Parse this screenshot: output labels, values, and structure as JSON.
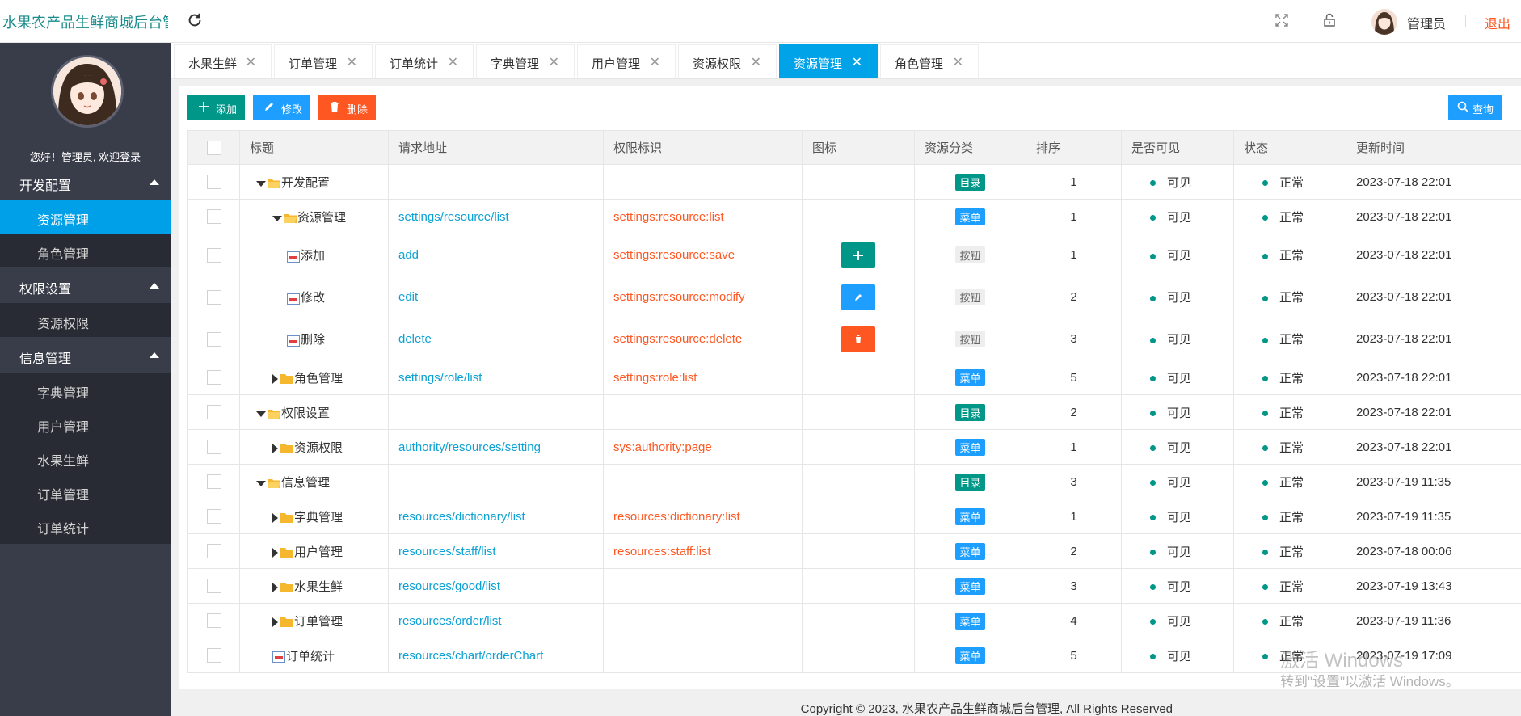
{
  "header": {
    "app_title": "水果农产品生鲜商城后台管",
    "user_name": "管理员",
    "logout": "退出"
  },
  "sidebar": {
    "welcome": "您好！管理员, 欢迎登录",
    "groups": [
      {
        "label": "开发配置",
        "items": [
          "资源管理",
          "角色管理"
        ]
      },
      {
        "label": "权限设置",
        "items": [
          "资源权限"
        ]
      },
      {
        "label": "信息管理",
        "items": [
          "字典管理",
          "用户管理",
          "水果生鲜",
          "订单管理",
          "订单统计"
        ]
      }
    ],
    "active_item": "资源管理"
  },
  "tabs": [
    "水果生鲜",
    "订单管理",
    "订单统计",
    "字典管理",
    "用户管理",
    "资源权限",
    "资源管理",
    "角色管理"
  ],
  "active_tab": "资源管理",
  "toolbar": {
    "add": "添加",
    "edit": "修改",
    "delete": "删除",
    "query": "查询"
  },
  "table": {
    "headers": [
      "标题",
      "请求地址",
      "权限标识",
      "图标",
      "资源分类",
      "排序",
      "是否可见",
      "状态",
      "更新时间"
    ],
    "rows": [
      {
        "title": "开发配置",
        "level": 0,
        "node": "open",
        "url": "",
        "perm": "",
        "icon": "",
        "type": "目录",
        "sort": "1",
        "visible": "可见",
        "status": "正常",
        "time": "2023-07-18 22:01"
      },
      {
        "title": "资源管理",
        "level": 1,
        "node": "open",
        "url": "settings/resource/list",
        "perm": "settings:resource:list",
        "icon": "",
        "type": "菜单",
        "sort": "1",
        "visible": "可见",
        "status": "正常",
        "time": "2023-07-18 22:01"
      },
      {
        "title": "添加",
        "level": 2,
        "node": "leaf",
        "url": "add",
        "perm": "settings:resource:save",
        "icon": "add",
        "type": "按钮",
        "sort": "1",
        "visible": "可见",
        "status": "正常",
        "time": "2023-07-18 22:01"
      },
      {
        "title": "修改",
        "level": 2,
        "node": "leaf",
        "url": "edit",
        "perm": "settings:resource:modify",
        "icon": "edit",
        "type": "按钮",
        "sort": "2",
        "visible": "可见",
        "status": "正常",
        "time": "2023-07-18 22:01"
      },
      {
        "title": "删除",
        "level": 2,
        "node": "leaf",
        "url": "delete",
        "perm": "settings:resource:delete",
        "icon": "delete",
        "type": "按钮",
        "sort": "3",
        "visible": "可见",
        "status": "正常",
        "time": "2023-07-18 22:01"
      },
      {
        "title": "角色管理",
        "level": 1,
        "node": "closed",
        "url": "settings/role/list",
        "perm": "settings:role:list",
        "icon": "",
        "type": "菜单",
        "sort": "5",
        "visible": "可见",
        "status": "正常",
        "time": "2023-07-18 22:01"
      },
      {
        "title": "权限设置",
        "level": 0,
        "node": "open",
        "url": "",
        "perm": "",
        "icon": "",
        "type": "目录",
        "sort": "2",
        "visible": "可见",
        "status": "正常",
        "time": "2023-07-18 22:01"
      },
      {
        "title": "资源权限",
        "level": 1,
        "node": "closed",
        "url": "authority/resources/setting",
        "perm": "sys:authority:page",
        "icon": "",
        "type": "菜单",
        "sort": "1",
        "visible": "可见",
        "status": "正常",
        "time": "2023-07-18 22:01"
      },
      {
        "title": "信息管理",
        "level": 0,
        "node": "open",
        "url": "",
        "perm": "",
        "icon": "",
        "type": "目录",
        "sort": "3",
        "visible": "可见",
        "status": "正常",
        "time": "2023-07-19 11:35"
      },
      {
        "title": "字典管理",
        "level": 1,
        "node": "closed",
        "url": "resources/dictionary/list",
        "perm": "resources:dictionary:list",
        "icon": "",
        "type": "菜单",
        "sort": "1",
        "visible": "可见",
        "status": "正常",
        "time": "2023-07-19 11:35"
      },
      {
        "title": "用户管理",
        "level": 1,
        "node": "closed",
        "url": "resources/staff/list",
        "perm": "resources:staff:list",
        "icon": "",
        "type": "菜单",
        "sort": "2",
        "visible": "可见",
        "status": "正常",
        "time": "2023-07-18 00:06"
      },
      {
        "title": "水果生鲜",
        "level": 1,
        "node": "closed",
        "url": "resources/good/list",
        "perm": "",
        "icon": "",
        "type": "菜单",
        "sort": "3",
        "visible": "可见",
        "status": "正常",
        "time": "2023-07-19 13:43"
      },
      {
        "title": "订单管理",
        "level": 1,
        "node": "closed",
        "url": "resources/order/list",
        "perm": "",
        "icon": "",
        "type": "菜单",
        "sort": "4",
        "visible": "可见",
        "status": "正常",
        "time": "2023-07-19 11:36"
      },
      {
        "title": "订单统计",
        "level": 1,
        "node": "leaf",
        "url": "resources/chart/orderChart",
        "perm": "",
        "icon": "",
        "type": "菜单",
        "sort": "5",
        "visible": "可见",
        "status": "正常",
        "time": "2023-07-19 17:09"
      }
    ]
  },
  "watermark": {
    "line1": "激活 Windows",
    "line2": "转到\"设置\"以激活 Windows。"
  },
  "footer": "Copyright © 2023, 水果农产品生鲜商城后台管理, All Rights Reserved",
  "colors": {
    "accent": "#00a2e8",
    "teal": "#009688",
    "blue": "#1e9fff",
    "orange": "#ff5722",
    "sidebar_bg": "#393d49"
  }
}
